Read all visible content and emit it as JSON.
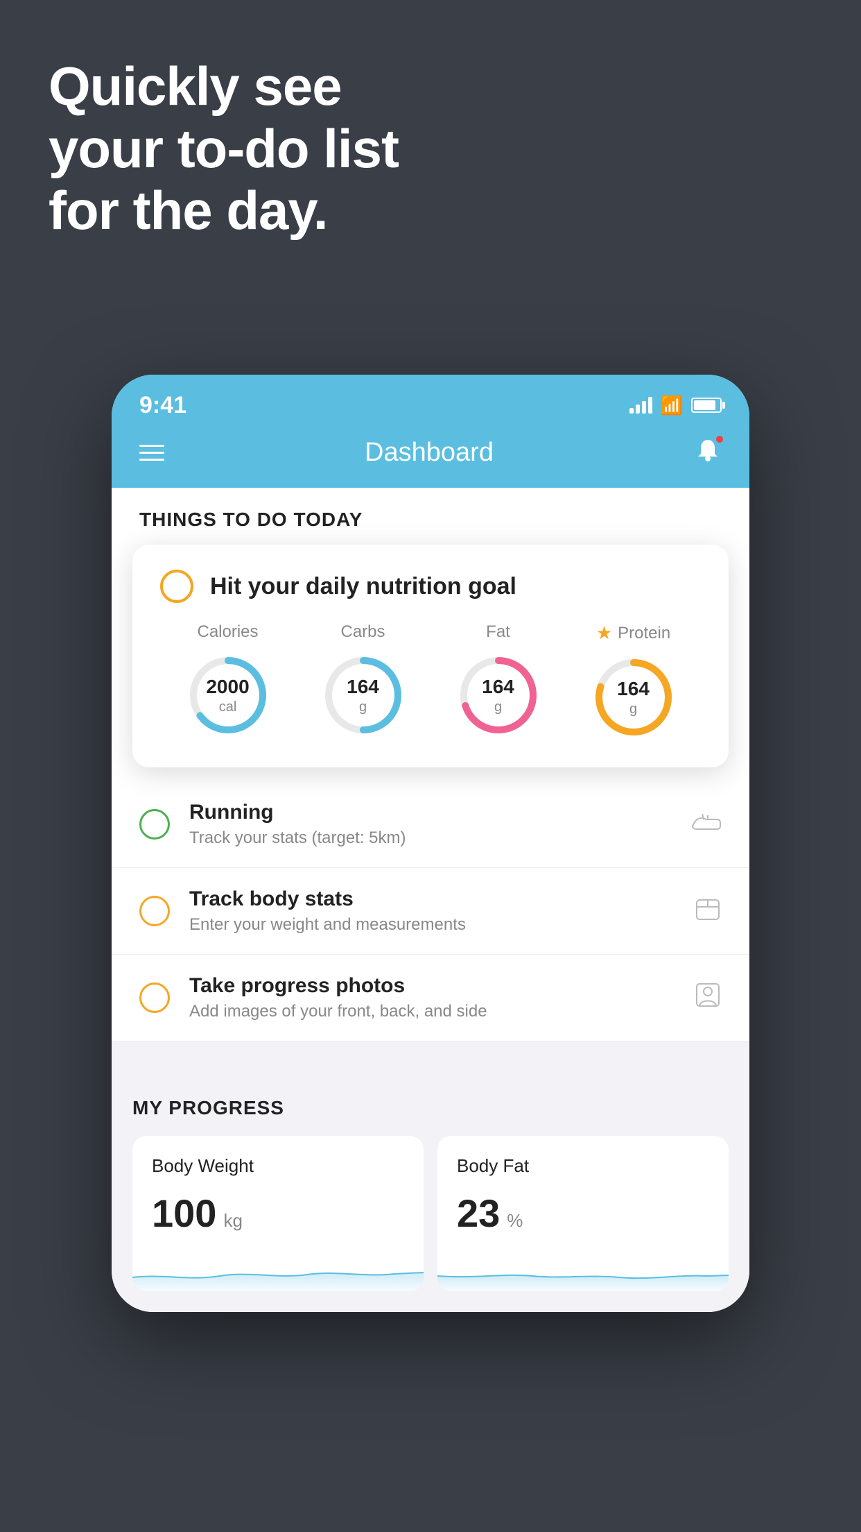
{
  "hero": {
    "line1": "Quickly see",
    "line2": "your to-do list",
    "line3": "for the day."
  },
  "statusBar": {
    "time": "9:41"
  },
  "header": {
    "title": "Dashboard"
  },
  "thingsToday": {
    "sectionTitle": "THINGS TO DO TODAY"
  },
  "nutritionCard": {
    "title": "Hit your daily nutrition goal",
    "metrics": [
      {
        "label": "Calories",
        "value": "2000",
        "unit": "cal",
        "color": "#5bbee0",
        "progress": 0.65
      },
      {
        "label": "Carbs",
        "value": "164",
        "unit": "g",
        "color": "#5bbee0",
        "progress": 0.5
      },
      {
        "label": "Fat",
        "value": "164",
        "unit": "g",
        "color": "#f06292",
        "progress": 0.7
      },
      {
        "label": "Protein",
        "value": "164",
        "unit": "g",
        "color": "#f5a623",
        "progress": 0.8,
        "starred": true
      }
    ]
  },
  "tasks": [
    {
      "name": "Running",
      "desc": "Track your stats (target: 5km)",
      "circleColor": "green",
      "icon": "shoe"
    },
    {
      "name": "Track body stats",
      "desc": "Enter your weight and measurements",
      "circleColor": "yellow",
      "icon": "scale"
    },
    {
      "name": "Take progress photos",
      "desc": "Add images of your front, back, and side",
      "circleColor": "yellow",
      "icon": "person"
    }
  ],
  "progress": {
    "sectionTitle": "MY PROGRESS",
    "cards": [
      {
        "title": "Body Weight",
        "value": "100",
        "unit": "kg"
      },
      {
        "title": "Body Fat",
        "value": "23",
        "unit": "%"
      }
    ]
  }
}
